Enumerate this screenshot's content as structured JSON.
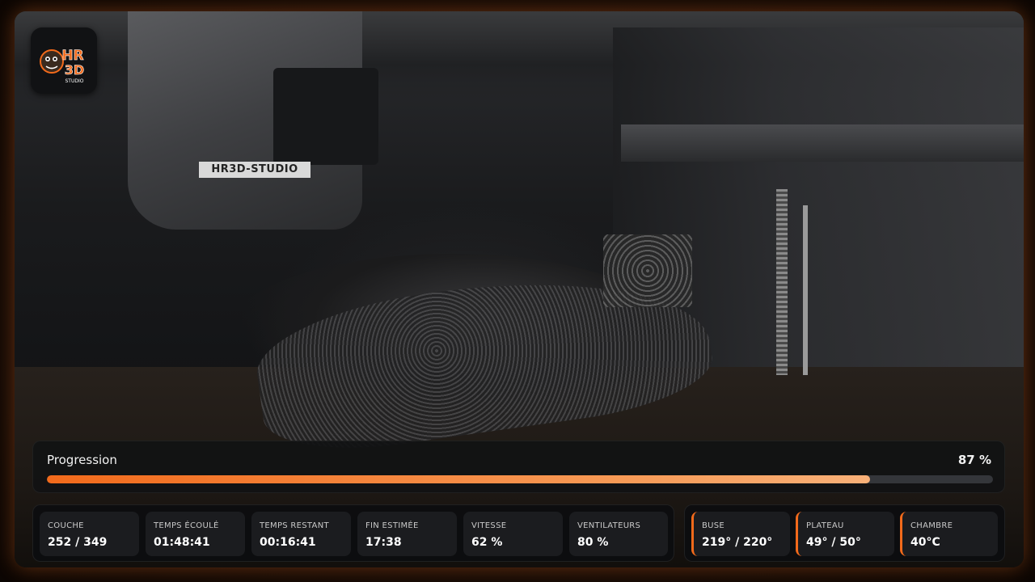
{
  "logo": {
    "text_top": "HR",
    "text_bottom": "3D",
    "text_small": "STUDIO"
  },
  "scene": {
    "toolhead_label": "HR3D-STUDIO"
  },
  "progress": {
    "label": "Progression",
    "percent_text": "87 %",
    "value": 0.87
  },
  "job_stats": [
    {
      "label": "COUCHE",
      "value": "252 / 349"
    },
    {
      "label": "TEMPS ÉCOULÉ",
      "value": "01:48:41"
    },
    {
      "label": "TEMPS RESTANT",
      "value": "00:16:41"
    },
    {
      "label": "FIN ESTIMÉE",
      "value": "17:38"
    },
    {
      "label": "VITESSE",
      "value": "62 %"
    },
    {
      "label": "VENTILATEURS",
      "value": "80 %"
    }
  ],
  "temps": [
    {
      "label": "BUSE",
      "value": "219° / 220°"
    },
    {
      "label": "PLATEAU",
      "value": "49° / 50°"
    },
    {
      "label": "CHAMBRE",
      "value": "40°C"
    }
  ],
  "colors": {
    "accent": "#f26a1b",
    "panel_bg": "#111214",
    "stat_bg": "#1b1c1f"
  }
}
